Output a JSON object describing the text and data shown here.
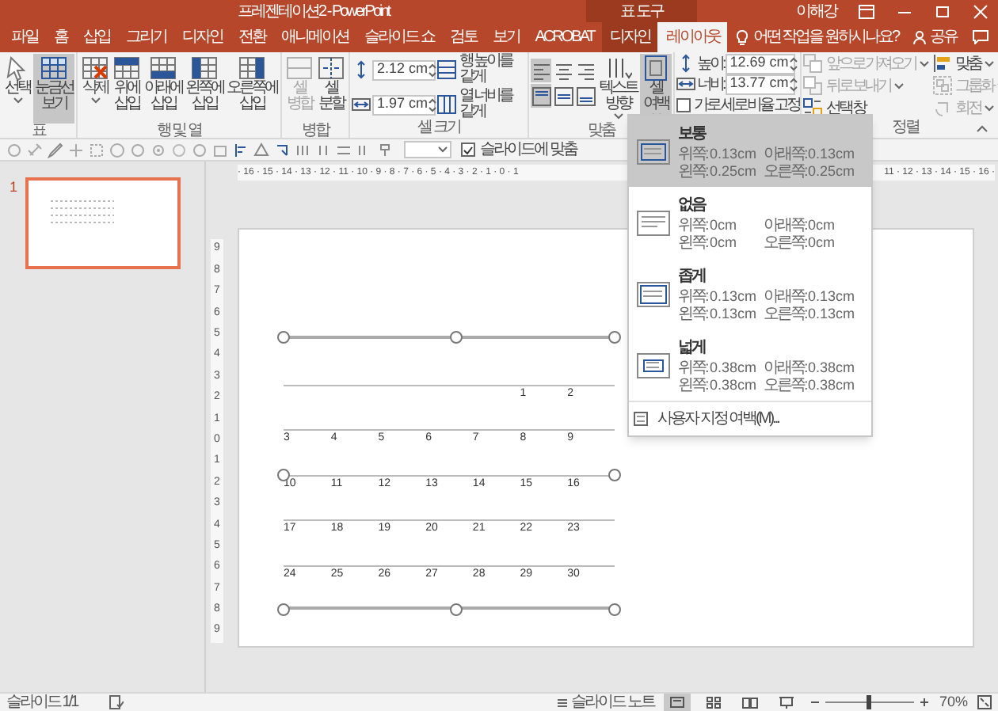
{
  "window": {
    "title": "프레젠테이션2 - PowerPoint",
    "context_title": "표 도구",
    "user": "이해강"
  },
  "tabs": [
    {
      "label": "파일",
      "selected": false,
      "contextual": false
    },
    {
      "label": "홈",
      "selected": false,
      "contextual": false
    },
    {
      "label": "삽입",
      "selected": false,
      "contextual": false
    },
    {
      "label": "그리기",
      "selected": false,
      "contextual": false
    },
    {
      "label": "디자인",
      "selected": false,
      "contextual": false
    },
    {
      "label": "전환",
      "selected": false,
      "contextual": false
    },
    {
      "label": "애니메이션",
      "selected": false,
      "contextual": false
    },
    {
      "label": "슬라이드 쇼",
      "selected": false,
      "contextual": false
    },
    {
      "label": "검토",
      "selected": false,
      "contextual": false
    },
    {
      "label": "보기",
      "selected": false,
      "contextual": false
    },
    {
      "label": "ACROBAT",
      "selected": false,
      "contextual": false
    },
    {
      "label": "디자인",
      "selected": false,
      "contextual": true
    },
    {
      "label": "레이아웃",
      "selected": true,
      "contextual": true
    }
  ],
  "tell_me": {
    "placeholder": "어떤 작업을 원하시나요?"
  },
  "share": {
    "label": "공유"
  },
  "ribbon": {
    "groups": [
      {
        "kind": "buttons",
        "label": "표",
        "buttons": [
          {
            "kind": "select",
            "label": "선택",
            "dropdown": true,
            "selected": false,
            "disabled": false
          },
          {
            "kind": "gridlines",
            "label": "눈금선 보기",
            "dropdown": false,
            "selected": true,
            "disabled": false
          }
        ]
      },
      {
        "kind": "buttons",
        "label": "행 및 열",
        "buttons": [
          {
            "kind": "delete",
            "label": "삭제",
            "dropdown": true,
            "selected": false,
            "disabled": false
          },
          {
            "kind": "insert-above",
            "label": "위에 삽입",
            "dropdown": false,
            "selected": false,
            "disabled": false
          },
          {
            "kind": "insert-below",
            "label": "아래에 삽입",
            "dropdown": false,
            "selected": false,
            "disabled": false
          },
          {
            "kind": "insert-left",
            "label": "왼쪽에 삽입",
            "dropdown": false,
            "selected": false,
            "disabled": false
          },
          {
            "kind": "insert-right",
            "label": "오른쪽에 삽입",
            "dropdown": false,
            "selected": false,
            "disabled": false
          }
        ]
      },
      {
        "kind": "buttons",
        "label": "병합",
        "buttons": [
          {
            "kind": "merge",
            "label": "셀 병합",
            "dropdown": false,
            "selected": false,
            "disabled": true
          },
          {
            "kind": "split",
            "label": "셀 분할",
            "dropdown": false,
            "selected": false,
            "disabled": false
          }
        ]
      },
      {
        "kind": "cell_size",
        "label": "셀 크기",
        "fields": [
          {
            "kind": "height",
            "value": "2.12 cm"
          },
          {
            "kind": "width",
            "value": "1.97 cm"
          }
        ],
        "buttons": [
          {
            "kind": "distribute-rows",
            "label": "행 높이를 같게"
          },
          {
            "kind": "distribute-columns",
            "label": "열 너비를 같게"
          }
        ]
      },
      {
        "kind": "alignment",
        "label": "맞춤",
        "align_buttons": [
          {
            "kind": "left",
            "selected": true
          },
          {
            "kind": "center",
            "selected": false
          },
          {
            "kind": "right",
            "selected": false
          },
          {
            "kind": "top",
            "selected": true
          },
          {
            "kind": "middle",
            "selected": false
          },
          {
            "kind": "bottom",
            "selected": false
          }
        ],
        "buttons": [
          {
            "kind": "text-direction",
            "label": "텍스트 방향",
            "dropdown": true,
            "selected": false,
            "disabled": false
          },
          {
            "kind": "cell-margins",
            "label": "셀 여백",
            "dropdown": true,
            "selected": true,
            "disabled": false
          }
        ]
      },
      {
        "kind": "table_size",
        "fields": [
          {
            "kind": "height",
            "label": "높이:",
            "value": "12.69 cm"
          },
          {
            "kind": "width",
            "label": "너비:",
            "value": "13.77 cm"
          }
        ],
        "lock": {
          "label": "가로 세로 비율 고정",
          "checked": false
        }
      },
      {
        "kind": "arrange",
        "label": "정렬",
        "buttons": [
          {
            "kind": "bring-forward",
            "label": "앞으로 가져오기",
            "dropdown": true,
            "disabled": true
          },
          {
            "kind": "send-backward",
            "label": "뒤로 보내기",
            "dropdown": true,
            "disabled": true
          },
          {
            "kind": "selection-pane",
            "label": "선택 창",
            "dropdown": false,
            "disabled": false
          },
          {
            "kind": "align-objects",
            "label": "맞춤",
            "dropdown": true,
            "disabled": false
          },
          {
            "kind": "group",
            "label": "그룹화",
            "dropdown": true,
            "disabled": true
          },
          {
            "kind": "rotate",
            "label": "회전",
            "dropdown": true,
            "disabled": true
          }
        ]
      }
    ]
  },
  "toolbar": {
    "fit_to_slide": {
      "label": "슬라이드에 맞춤",
      "checked": true
    }
  },
  "thumbnails": [
    {
      "number": "1",
      "selected": true
    }
  ],
  "ruler": {
    "left": "· 16 · 15 · 14 · 13 · 12 · 11 · 10 · 9 · 8 · 7 · 6 · 5 · 4 · 3 · 2 · 1 · 0 · 1",
    "right": "11 · 12 · 13 · 14 · 15 · 16 ·",
    "vertical": [
      "9",
      "8",
      "7",
      "6",
      "5",
      "4",
      "3",
      "2",
      "1",
      "0",
      "1",
      "2",
      "3",
      "4",
      "5",
      "6",
      "7",
      "8",
      "9"
    ]
  },
  "table": {
    "rows": [
      [
        null,
        null,
        null,
        null,
        null,
        null,
        null
      ],
      [
        null,
        null,
        null,
        null,
        null,
        "1",
        "2"
      ],
      [
        "3",
        "4",
        "5",
        "6",
        "7",
        "8",
        "9"
      ],
      [
        "10",
        "11",
        "12",
        "13",
        "14",
        "15",
        "16"
      ],
      [
        "17",
        "18",
        "19",
        "20",
        "21",
        "22",
        "23"
      ],
      [
        "24",
        "25",
        "26",
        "27",
        "28",
        "29",
        "30"
      ]
    ]
  },
  "margins_menu": {
    "items": [
      {
        "kind": "normal",
        "name": "보통",
        "selected": true,
        "fields": [
          {
            "label": "위쪽:",
            "value": "0.13cm"
          },
          {
            "label": "아래쪽:",
            "value": "0.13cm"
          },
          {
            "label": "왼쪽:",
            "value": "0.25cm"
          },
          {
            "label": "오른쪽:",
            "value": "0.25cm"
          }
        ]
      },
      {
        "kind": "none",
        "name": "없음",
        "selected": false,
        "fields": [
          {
            "label": "위쪽:",
            "value": "0cm"
          },
          {
            "label": "아래쪽:",
            "value": "0cm"
          },
          {
            "label": "왼쪽:",
            "value": "0cm"
          },
          {
            "label": "오른쪽:",
            "value": "0cm"
          }
        ]
      },
      {
        "kind": "narrow",
        "name": "좁게",
        "selected": false,
        "fields": [
          {
            "label": "위쪽:",
            "value": "0.13cm"
          },
          {
            "label": "아래쪽:",
            "value": "0.13cm"
          },
          {
            "label": "왼쪽:",
            "value": "0.13cm"
          },
          {
            "label": "오른쪽:",
            "value": "0.13cm"
          }
        ]
      },
      {
        "kind": "wide",
        "name": "넓게",
        "selected": false,
        "fields": [
          {
            "label": "위쪽:",
            "value": "0.38cm"
          },
          {
            "label": "아래쪽:",
            "value": "0.38cm"
          },
          {
            "label": "왼쪽:",
            "value": "0.38cm"
          },
          {
            "label": "오른쪽:",
            "value": "0.38cm"
          }
        ]
      }
    ],
    "custom": "사용자 지정 여백(M)..."
  },
  "status_bar": {
    "slide": "슬라이드 1/1",
    "notes": "슬라이드 노트",
    "views": [
      {
        "kind": "normal",
        "selected": true
      },
      {
        "kind": "sorter",
        "selected": false
      },
      {
        "kind": "reading",
        "selected": false
      },
      {
        "kind": "slideshow",
        "selected": false
      }
    ],
    "zoom": {
      "level": 0.5,
      "label": "70%"
    }
  }
}
